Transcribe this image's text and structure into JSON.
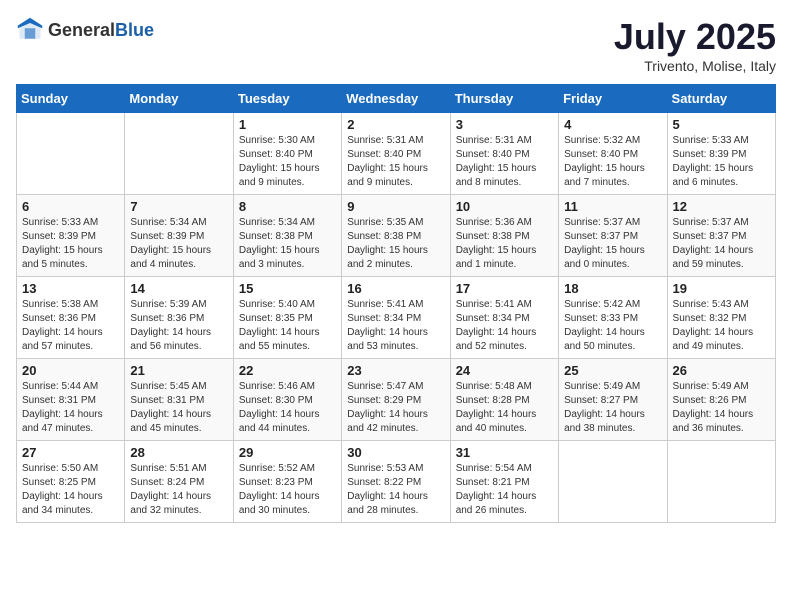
{
  "header": {
    "logo_general": "General",
    "logo_blue": "Blue",
    "month_year": "July 2025",
    "location": "Trivento, Molise, Italy"
  },
  "weekdays": [
    "Sunday",
    "Monday",
    "Tuesday",
    "Wednesday",
    "Thursday",
    "Friday",
    "Saturday"
  ],
  "weeks": [
    [
      {
        "day": "",
        "info": ""
      },
      {
        "day": "",
        "info": ""
      },
      {
        "day": "1",
        "info": "Sunrise: 5:30 AM\nSunset: 8:40 PM\nDaylight: 15 hours\nand 9 minutes."
      },
      {
        "day": "2",
        "info": "Sunrise: 5:31 AM\nSunset: 8:40 PM\nDaylight: 15 hours\nand 9 minutes."
      },
      {
        "day": "3",
        "info": "Sunrise: 5:31 AM\nSunset: 8:40 PM\nDaylight: 15 hours\nand 8 minutes."
      },
      {
        "day": "4",
        "info": "Sunrise: 5:32 AM\nSunset: 8:40 PM\nDaylight: 15 hours\nand 7 minutes."
      },
      {
        "day": "5",
        "info": "Sunrise: 5:33 AM\nSunset: 8:39 PM\nDaylight: 15 hours\nand 6 minutes."
      }
    ],
    [
      {
        "day": "6",
        "info": "Sunrise: 5:33 AM\nSunset: 8:39 PM\nDaylight: 15 hours\nand 5 minutes."
      },
      {
        "day": "7",
        "info": "Sunrise: 5:34 AM\nSunset: 8:39 PM\nDaylight: 15 hours\nand 4 minutes."
      },
      {
        "day": "8",
        "info": "Sunrise: 5:34 AM\nSunset: 8:38 PM\nDaylight: 15 hours\nand 3 minutes."
      },
      {
        "day": "9",
        "info": "Sunrise: 5:35 AM\nSunset: 8:38 PM\nDaylight: 15 hours\nand 2 minutes."
      },
      {
        "day": "10",
        "info": "Sunrise: 5:36 AM\nSunset: 8:38 PM\nDaylight: 15 hours\nand 1 minute."
      },
      {
        "day": "11",
        "info": "Sunrise: 5:37 AM\nSunset: 8:37 PM\nDaylight: 15 hours\nand 0 minutes."
      },
      {
        "day": "12",
        "info": "Sunrise: 5:37 AM\nSunset: 8:37 PM\nDaylight: 14 hours\nand 59 minutes."
      }
    ],
    [
      {
        "day": "13",
        "info": "Sunrise: 5:38 AM\nSunset: 8:36 PM\nDaylight: 14 hours\nand 57 minutes."
      },
      {
        "day": "14",
        "info": "Sunrise: 5:39 AM\nSunset: 8:36 PM\nDaylight: 14 hours\nand 56 minutes."
      },
      {
        "day": "15",
        "info": "Sunrise: 5:40 AM\nSunset: 8:35 PM\nDaylight: 14 hours\nand 55 minutes."
      },
      {
        "day": "16",
        "info": "Sunrise: 5:41 AM\nSunset: 8:34 PM\nDaylight: 14 hours\nand 53 minutes."
      },
      {
        "day": "17",
        "info": "Sunrise: 5:41 AM\nSunset: 8:34 PM\nDaylight: 14 hours\nand 52 minutes."
      },
      {
        "day": "18",
        "info": "Sunrise: 5:42 AM\nSunset: 8:33 PM\nDaylight: 14 hours\nand 50 minutes."
      },
      {
        "day": "19",
        "info": "Sunrise: 5:43 AM\nSunset: 8:32 PM\nDaylight: 14 hours\nand 49 minutes."
      }
    ],
    [
      {
        "day": "20",
        "info": "Sunrise: 5:44 AM\nSunset: 8:31 PM\nDaylight: 14 hours\nand 47 minutes."
      },
      {
        "day": "21",
        "info": "Sunrise: 5:45 AM\nSunset: 8:31 PM\nDaylight: 14 hours\nand 45 minutes."
      },
      {
        "day": "22",
        "info": "Sunrise: 5:46 AM\nSunset: 8:30 PM\nDaylight: 14 hours\nand 44 minutes."
      },
      {
        "day": "23",
        "info": "Sunrise: 5:47 AM\nSunset: 8:29 PM\nDaylight: 14 hours\nand 42 minutes."
      },
      {
        "day": "24",
        "info": "Sunrise: 5:48 AM\nSunset: 8:28 PM\nDaylight: 14 hours\nand 40 minutes."
      },
      {
        "day": "25",
        "info": "Sunrise: 5:49 AM\nSunset: 8:27 PM\nDaylight: 14 hours\nand 38 minutes."
      },
      {
        "day": "26",
        "info": "Sunrise: 5:49 AM\nSunset: 8:26 PM\nDaylight: 14 hours\nand 36 minutes."
      }
    ],
    [
      {
        "day": "27",
        "info": "Sunrise: 5:50 AM\nSunset: 8:25 PM\nDaylight: 14 hours\nand 34 minutes."
      },
      {
        "day": "28",
        "info": "Sunrise: 5:51 AM\nSunset: 8:24 PM\nDaylight: 14 hours\nand 32 minutes."
      },
      {
        "day": "29",
        "info": "Sunrise: 5:52 AM\nSunset: 8:23 PM\nDaylight: 14 hours\nand 30 minutes."
      },
      {
        "day": "30",
        "info": "Sunrise: 5:53 AM\nSunset: 8:22 PM\nDaylight: 14 hours\nand 28 minutes."
      },
      {
        "day": "31",
        "info": "Sunrise: 5:54 AM\nSunset: 8:21 PM\nDaylight: 14 hours\nand 26 minutes."
      },
      {
        "day": "",
        "info": ""
      },
      {
        "day": "",
        "info": ""
      }
    ]
  ]
}
